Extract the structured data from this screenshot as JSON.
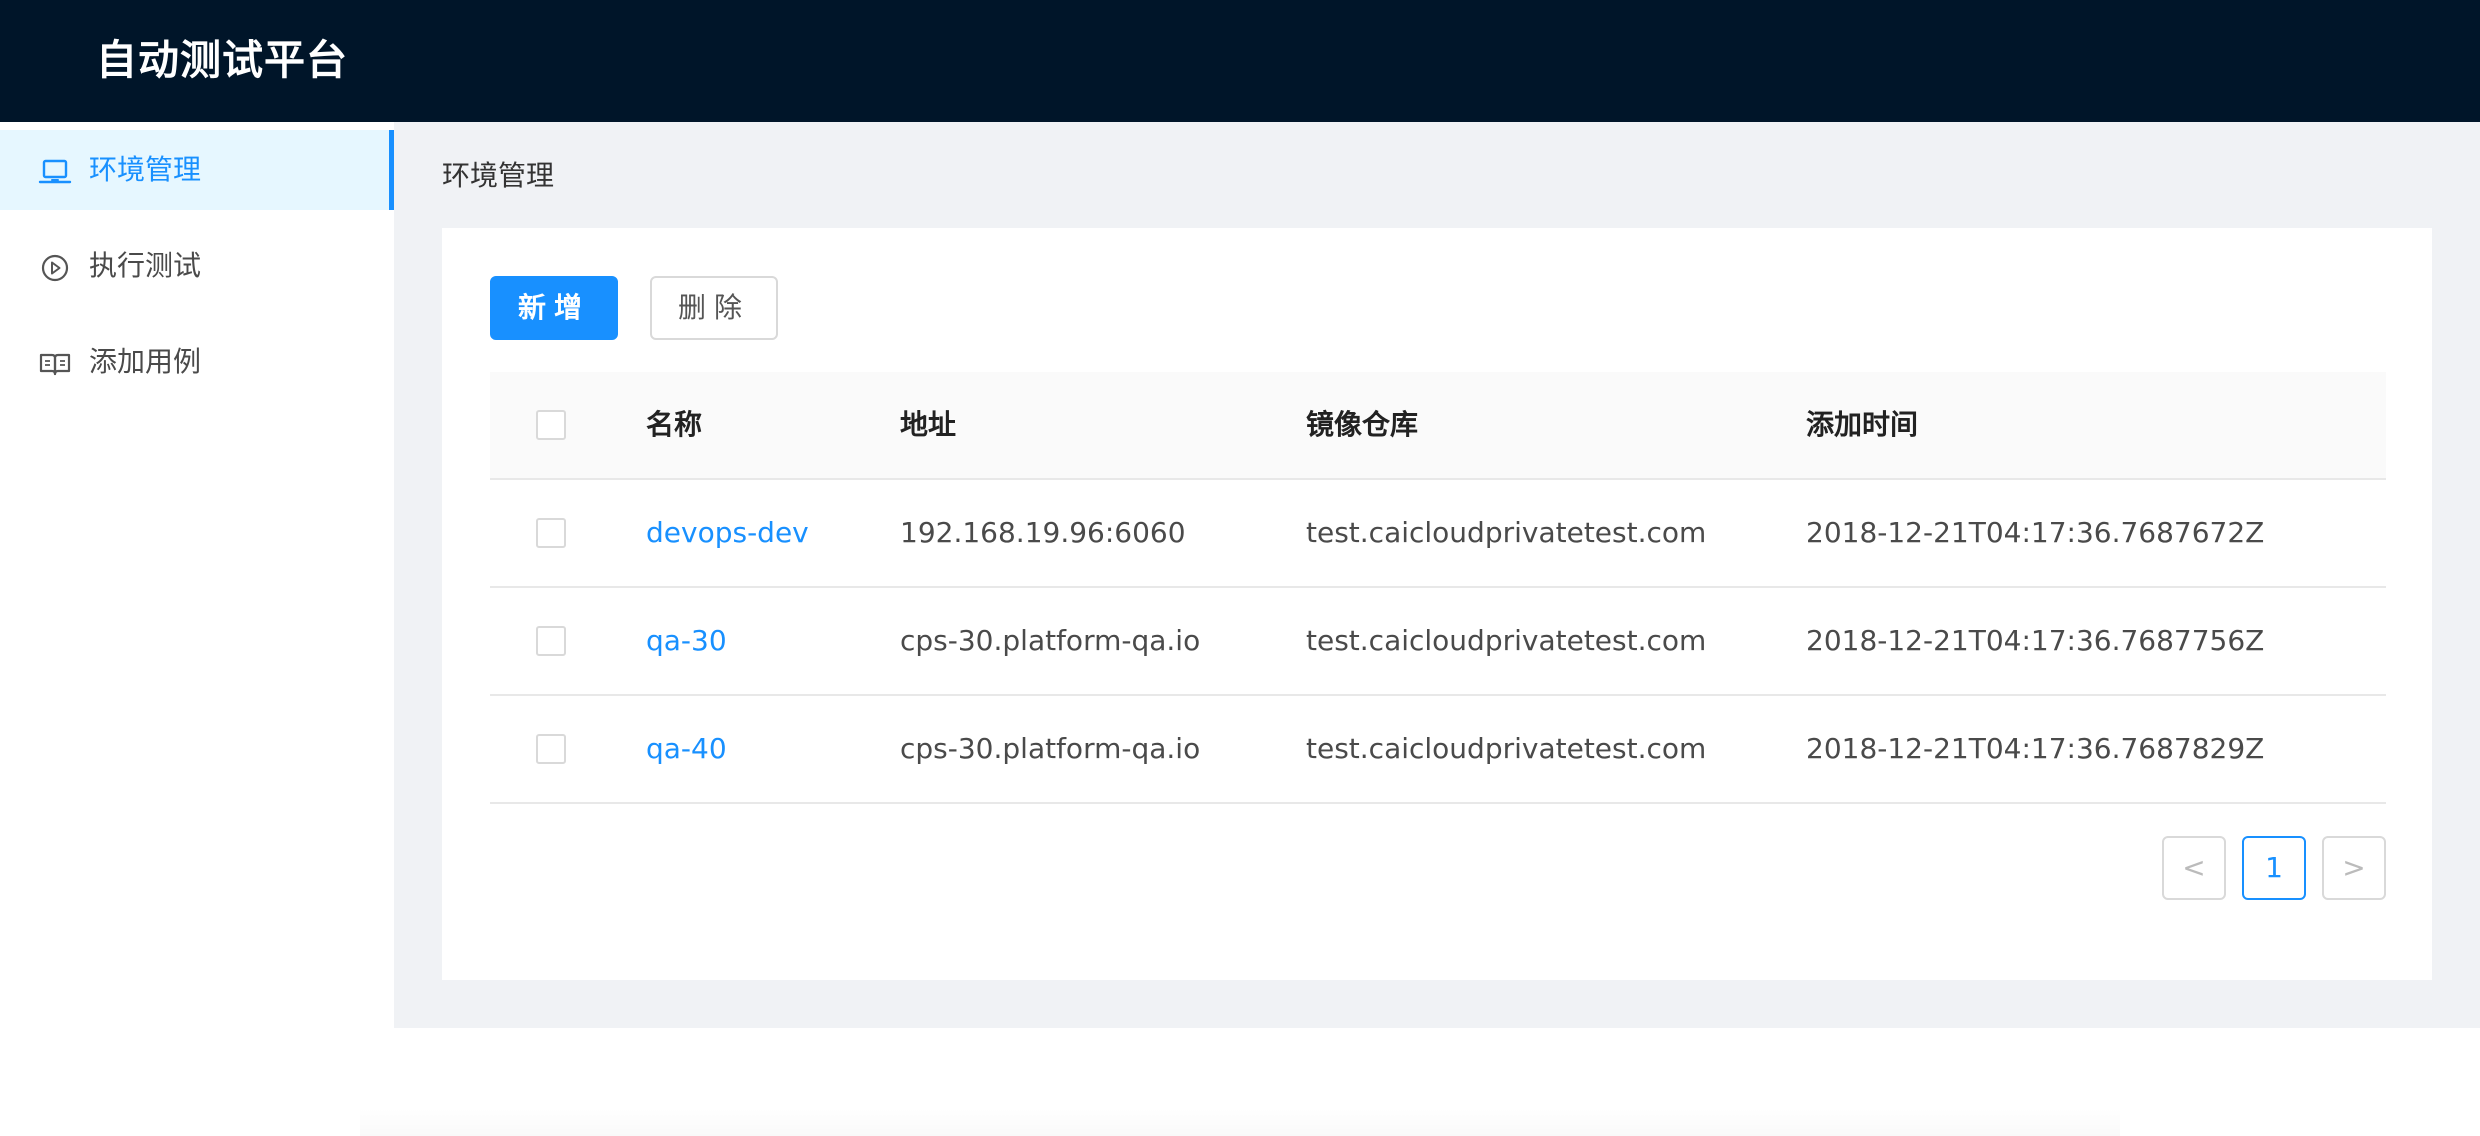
{
  "app": {
    "title": "自动测试平台"
  },
  "sidebar": {
    "items": [
      {
        "label": "环境管理",
        "icon": "laptop-icon",
        "active": true
      },
      {
        "label": "执行测试",
        "icon": "play-circle-icon",
        "active": false
      },
      {
        "label": "添加用例",
        "icon": "book-open-icon",
        "active": false
      }
    ]
  },
  "breadcrumb": "环境管理",
  "toolbar": {
    "add_label": "新增",
    "delete_label": "删除"
  },
  "table": {
    "columns": [
      "名称",
      "地址",
      "镜像仓库",
      "添加时间"
    ],
    "rows": [
      {
        "name": "devops-dev",
        "address": "192.168.19.96:6060",
        "registry": "test.caicloudprivatetest.com",
        "created": "2018-12-21T04:17:36.7687672Z"
      },
      {
        "name": "qa-30",
        "address": "cps-30.platform-qa.io",
        "registry": "test.caicloudprivatetest.com",
        "created": "2018-12-21T04:17:36.7687756Z"
      },
      {
        "name": "qa-40",
        "address": "cps-30.platform-qa.io",
        "registry": "test.caicloudprivatetest.com",
        "created": "2018-12-21T04:17:36.7687829Z"
      }
    ]
  },
  "pagination": {
    "prev": "<",
    "current": "1",
    "next": ">"
  },
  "colors": {
    "header_bg": "#001529",
    "accent": "#1890ff",
    "content_bg": "#f0f2f5"
  }
}
